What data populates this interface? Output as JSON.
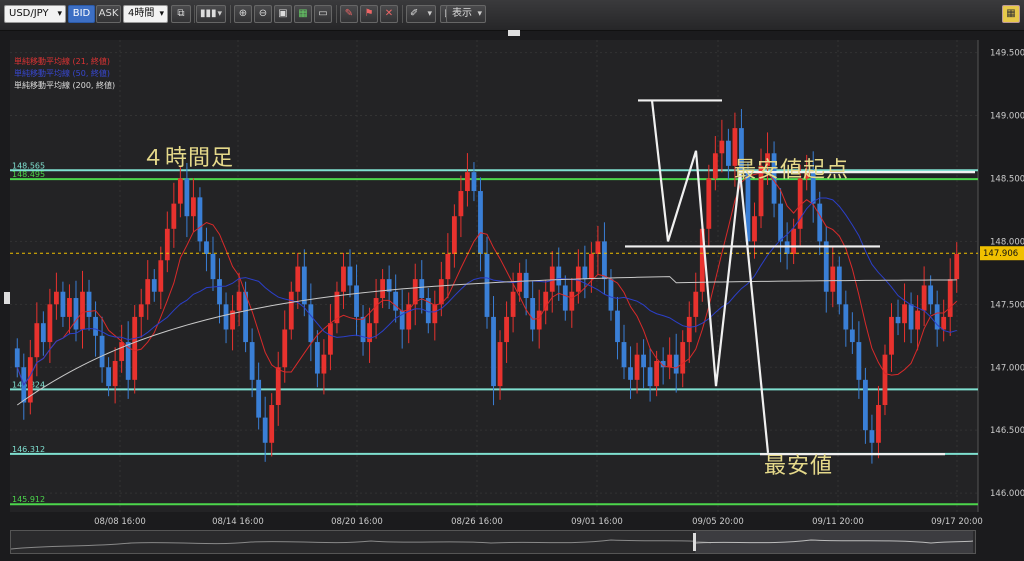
{
  "toolbar": {
    "symbol": "USD/JPY",
    "bid_label": "BID",
    "ask_label": "ASK",
    "timeframe": "4時間",
    "display_label": "表示"
  },
  "legend": {
    "ma21": "単純移動平均線 (21, 終値)",
    "ma50": "単純移動平均線 (50, 終値)",
    "ma200": "単純移動平均線 (200, 終値)"
  },
  "annotations": {
    "timeframe_caption": "４時間足",
    "lowest_start": "最安値起点",
    "lowest": "最安値"
  },
  "hlines": [
    {
      "label": "148.565",
      "value": 148.565,
      "color": "#7fe0d0"
    },
    {
      "label": "148.495",
      "value": 148.495,
      "color": "#4cd64c"
    },
    {
      "label": "146.824",
      "value": 146.824,
      "color": "#7fe0d0"
    },
    {
      "label": "146.312",
      "value": 146.312,
      "color": "#7fe0d0"
    },
    {
      "label": "145.912",
      "value": 145.912,
      "color": "#4cd64c"
    }
  ],
  "current_price": {
    "label": "147.906",
    "value": 147.906
  },
  "colors": {
    "up": "#e8322e",
    "down": "#3a7fd6",
    "ma21": "#d92a2a",
    "ma50": "#2b3fc9",
    "ma200": "#c9c9c9",
    "accent": "#f0c000"
  },
  "chart_data": {
    "type": "candlestick",
    "y_axis": {
      "min": 145.85,
      "max": 149.6,
      "ticks": [
        146.0,
        146.5,
        147.0,
        147.5,
        148.0,
        148.5,
        149.0,
        149.5
      ],
      "tick_labels": [
        "146.000",
        "146.500",
        "147.000",
        "147.500",
        "148.000",
        "148.500",
        "149.000",
        "149.500"
      ]
    },
    "x_axis": {
      "labels": [
        "08/08 16:00",
        "08/14 16:00",
        "08/20 16:00",
        "08/26 16:00",
        "09/01 16:00",
        "09/05 20:00",
        "09/11 20:00",
        "09/17 20:00"
      ]
    },
    "closes": [
      147.0,
      146.72,
      147.08,
      147.35,
      147.2,
      147.5,
      147.6,
      147.4,
      147.55,
      147.3,
      147.6,
      147.4,
      147.25,
      147.0,
      146.85,
      147.05,
      147.2,
      146.9,
      147.4,
      147.5,
      147.7,
      147.6,
      147.85,
      148.1,
      148.3,
      148.5,
      148.2,
      148.35,
      148.0,
      147.9,
      147.7,
      147.5,
      147.3,
      147.45,
      147.6,
      147.2,
      146.9,
      146.6,
      146.4,
      146.7,
      147.0,
      147.3,
      147.6,
      147.8,
      147.5,
      147.2,
      146.95,
      147.1,
      147.35,
      147.6,
      147.8,
      147.65,
      147.4,
      147.2,
      147.35,
      147.55,
      147.7,
      147.6,
      147.45,
      147.3,
      147.5,
      147.7,
      147.55,
      147.35,
      147.5,
      147.7,
      147.9,
      148.2,
      148.4,
      148.55,
      148.4,
      147.9,
      147.4,
      146.85,
      147.2,
      147.4,
      147.6,
      147.75,
      147.55,
      147.3,
      147.45,
      147.6,
      147.8,
      147.65,
      147.45,
      147.6,
      147.8,
      147.7,
      147.9,
      148.0,
      147.7,
      147.45,
      147.2,
      147.0,
      146.9,
      147.1,
      147.0,
      146.85,
      147.05,
      147.0,
      147.1,
      146.95,
      147.2,
      147.4,
      147.6,
      148.1,
      148.5,
      148.7,
      148.8,
      148.6,
      148.9,
      148.55,
      148.0,
      148.2,
      148.6,
      148.7,
      148.3,
      148.0,
      147.9,
      148.1,
      148.5,
      148.55,
      148.3,
      148.0,
      147.6,
      147.8,
      147.5,
      147.3,
      147.2,
      146.9,
      146.5,
      146.4,
      146.7,
      147.1,
      147.4,
      147.35,
      147.5,
      147.3,
      147.45,
      147.65,
      147.5,
      147.3,
      147.4,
      147.7,
      147.9
    ]
  }
}
